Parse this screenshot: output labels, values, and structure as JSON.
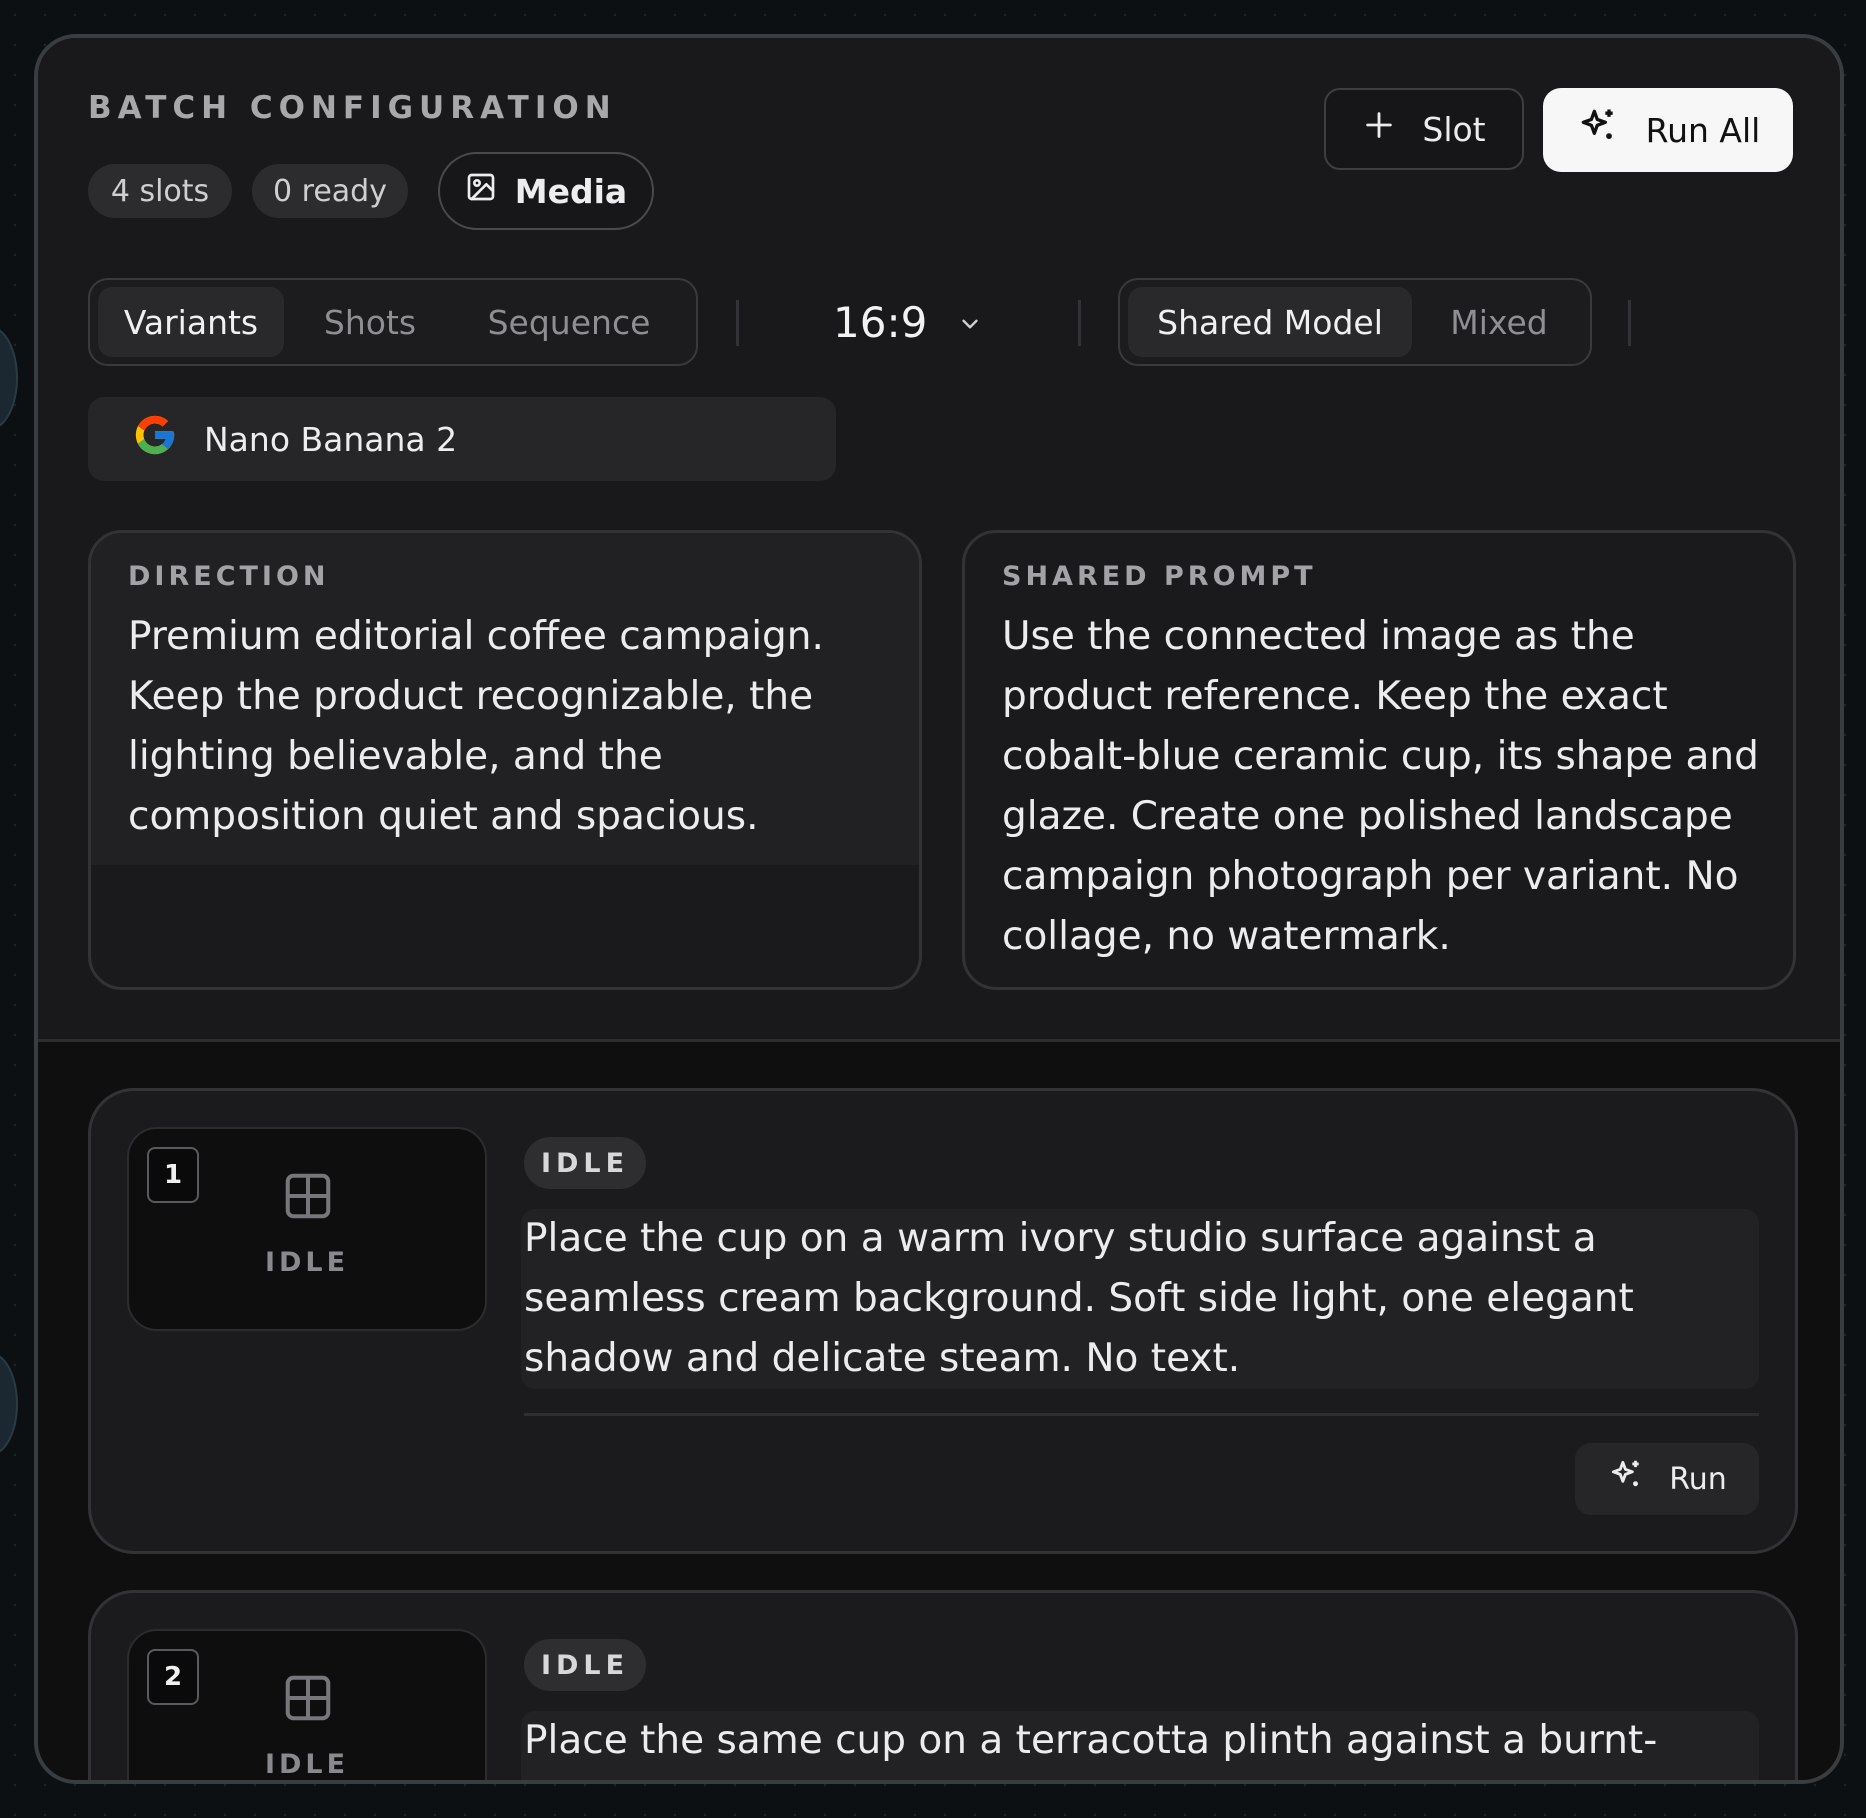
{
  "header": {
    "title": "BATCH CONFIGURATION",
    "slots_count": "4 slots",
    "ready_count": "0 ready",
    "media_label": "Media",
    "add_slot_label": "Slot",
    "run_all_label": "Run All"
  },
  "mode_tabs": [
    "Variants",
    "Shots",
    "Sequence"
  ],
  "mode_active": "Variants",
  "aspect_ratio": "16:9",
  "model_mode_tabs": [
    "Shared Model",
    "Mixed"
  ],
  "model_mode_active": "Shared Model",
  "model": {
    "name": "Nano Banana 2",
    "provider_icon": "google-icon"
  },
  "direction": {
    "label": "DIRECTION",
    "text": "Premium editorial coffee campaign. Keep the product recognizable, the lighting believable, and the composition quiet and spacious."
  },
  "shared_prompt": {
    "label": "SHARED PROMPT",
    "text": "Use the connected image as the product reference. Keep the exact cobalt-blue ceramic cup, its shape and glaze. Create one polished landscape campaign photograph per variant. No collage, no watermark."
  },
  "slots": [
    {
      "number": "1",
      "thumb_status": "IDLE",
      "status": "IDLE",
      "prompt": "Place the cup on a warm ivory studio surface against a seamless cream background. Soft side light, one elegant shadow and delicate steam. No text.",
      "run_label": "Run"
    },
    {
      "number": "2",
      "thumb_status": "IDLE",
      "status": "IDLE",
      "prompt": "Place the same cup on a terracotta plinth against a burnt-"
    }
  ],
  "colors": {
    "panel_bg": "#19191b",
    "accent_button": "#f7f7f8",
    "border": "#3a3d40"
  }
}
